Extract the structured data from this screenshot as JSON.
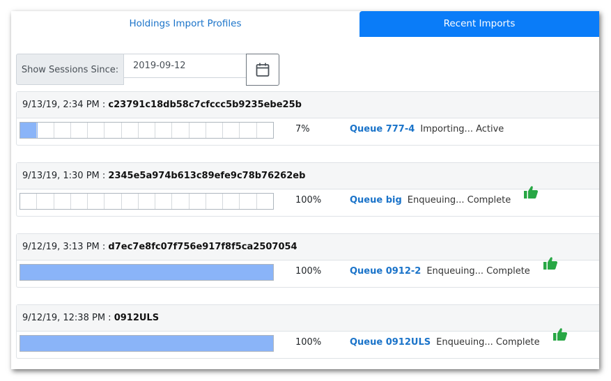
{
  "tabs": [
    {
      "label": "Holdings Import Profiles",
      "active": false
    },
    {
      "label": "Recent Imports",
      "active": true
    }
  ],
  "filter": {
    "label": "Show Sessions Since:",
    "value": "2019-09-12"
  },
  "colors": {
    "accent": "#0a7cf8",
    "link": "#1a73c9",
    "progress_fill": "#8ab4f8",
    "success": "#28a745"
  },
  "sessions": [
    {
      "time": "9/13/19, 2:34 PM",
      "id": "c23791c18db58c7cfccc5b9235ebe25b",
      "progress": 0.07,
      "percent": "7%",
      "queue": "Queue 777-4",
      "status": "Importing... Active",
      "complete": false
    },
    {
      "time": "9/13/19, 1:30 PM",
      "id": "2345e5a974b613c89efe9c78b76262eb",
      "progress": 0.0,
      "percent": "100%",
      "queue": "Queue big",
      "status": "Enqueuing... Complete",
      "complete": true
    },
    {
      "time": "9/12/19, 3:13 PM",
      "id": "d7ec7e8fc07f756e917f8f5ca2507054",
      "progress": 1.0,
      "percent": "100%",
      "queue": "Queue 0912-2",
      "status": "Enqueuing... Complete",
      "complete": true
    },
    {
      "time": "9/12/19, 12:38 PM",
      "id": "0912ULS",
      "progress": 1.0,
      "percent": "100%",
      "queue": "Queue 0912ULS",
      "status": "Enqueuing... Complete",
      "complete": true
    }
  ]
}
